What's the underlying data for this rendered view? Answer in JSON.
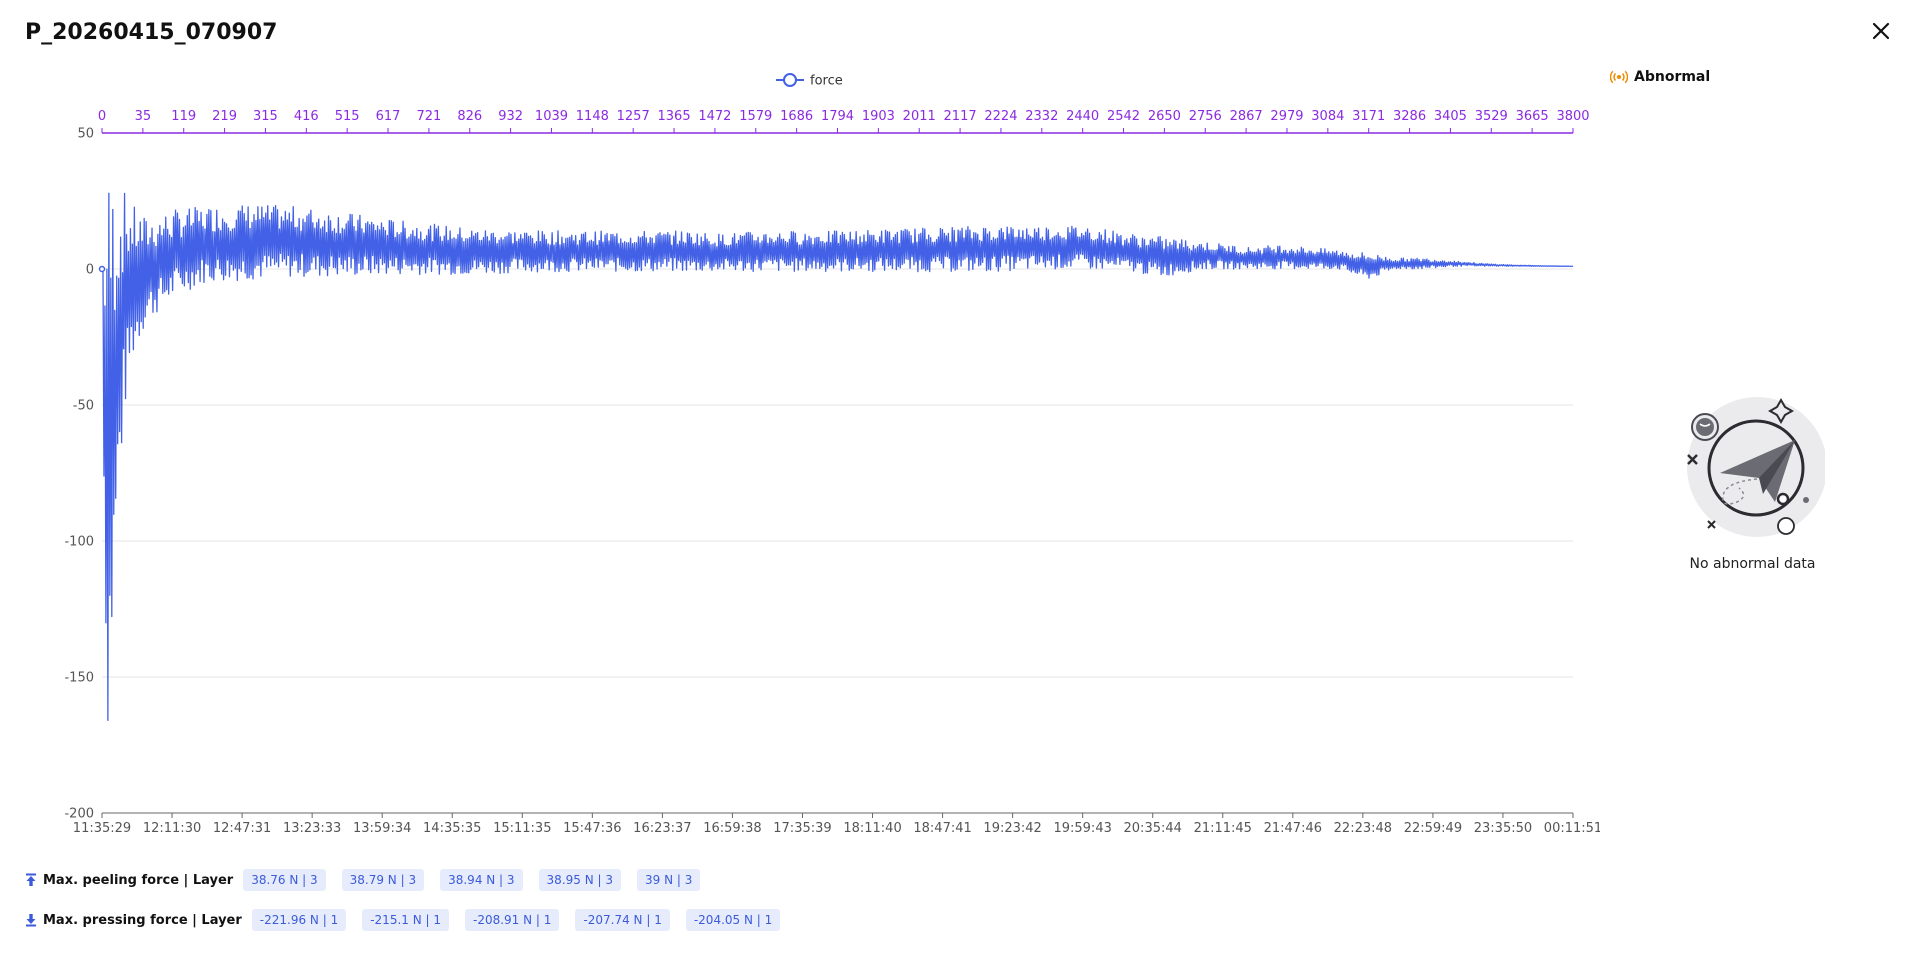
{
  "dialog": {
    "title": "P_20260415_070907"
  },
  "colors": {
    "series": "#4261e6",
    "top_axis": "#8a2be2",
    "abnormal_icon": "#f08c00",
    "tag_bg": "#e6ecfc",
    "tag_text": "#3b5bdb"
  },
  "chart_data": {
    "type": "line",
    "series": [
      {
        "name": "force"
      }
    ],
    "legend_position": "top-center",
    "grid": true,
    "ylim": [
      -200,
      50
    ],
    "y_ticks": [
      "50",
      "0",
      "-50",
      "-100",
      "-150",
      "-200"
    ],
    "x_bottom_ticks": [
      "11:35:29",
      "12:11:30",
      "12:47:31",
      "13:23:33",
      "13:59:34",
      "14:35:35",
      "15:11:35",
      "15:47:36",
      "16:23:37",
      "16:59:38",
      "17:35:39",
      "18:11:40",
      "18:47:41",
      "19:23:42",
      "19:59:43",
      "20:35:44",
      "21:11:45",
      "21:47:46",
      "22:23:48",
      "22:59:49",
      "23:35:50",
      "00:11:51"
    ],
    "x_top_ticks": [
      "0",
      "35",
      "119",
      "219",
      "315",
      "416",
      "515",
      "617",
      "721",
      "826",
      "932",
      "1039",
      "1148",
      "1257",
      "1365",
      "1472",
      "1579",
      "1686",
      "1794",
      "1903",
      "2011",
      "2117",
      "2224",
      "2332",
      "2440",
      "2542",
      "2650",
      "2756",
      "2867",
      "2979",
      "3084",
      "3171",
      "3286",
      "3405",
      "3529",
      "3665",
      "3800"
    ],
    "envelope": {
      "x_fraction": [
        0,
        0.003,
        0.006,
        0.01,
        0.015,
        0.02,
        0.03,
        0.05,
        0.07,
        0.1,
        0.13,
        0.15,
        0.2,
        0.25,
        0.3,
        0.35,
        0.4,
        0.42,
        0.45,
        0.5,
        0.55,
        0.6,
        0.65,
        0.67,
        0.7,
        0.72,
        0.75,
        0.78,
        0.8,
        0.82,
        0.84,
        0.86,
        0.88,
        0.9,
        0.92,
        0.94,
        0.96,
        0.98,
        1.0
      ],
      "upper": [
        0,
        37,
        36,
        33,
        29,
        24,
        19,
        22,
        23,
        24,
        23,
        22,
        18,
        15,
        14,
        14,
        14,
        13,
        14,
        14,
        15,
        16,
        16,
        16,
        13,
        12,
        10,
        8,
        9,
        8,
        7,
        6,
        4,
        4,
        3,
        2,
        1.5,
        1.2,
        1
      ],
      "lower": [
        0,
        -180,
        -155,
        -100,
        -55,
        -35,
        -20,
        -10,
        -5,
        -4,
        -3,
        -3,
        -2,
        -2,
        -1,
        -1,
        -1,
        -1,
        -1,
        -1,
        -1,
        -1,
        0,
        0,
        -1,
        -3,
        0,
        0,
        0,
        0,
        0,
        -4,
        0,
        0,
        1,
        1,
        1,
        1,
        1
      ]
    }
  },
  "abnormal": {
    "title": "Abnormal",
    "empty_text": "No abnormal data"
  },
  "stats": {
    "peeling_label": "Max. peeling force | Layer",
    "peeling_values": [
      "38.76 N | 3",
      "38.79 N | 3",
      "38.94 N | 3",
      "38.95 N | 3",
      "39 N | 3"
    ],
    "pressing_label": "Max. pressing force | Layer",
    "pressing_values": [
      "-221.96 N | 1",
      "-215.1 N | 1",
      "-208.91 N | 1",
      "-207.74 N | 1",
      "-204.05 N | 1"
    ]
  }
}
